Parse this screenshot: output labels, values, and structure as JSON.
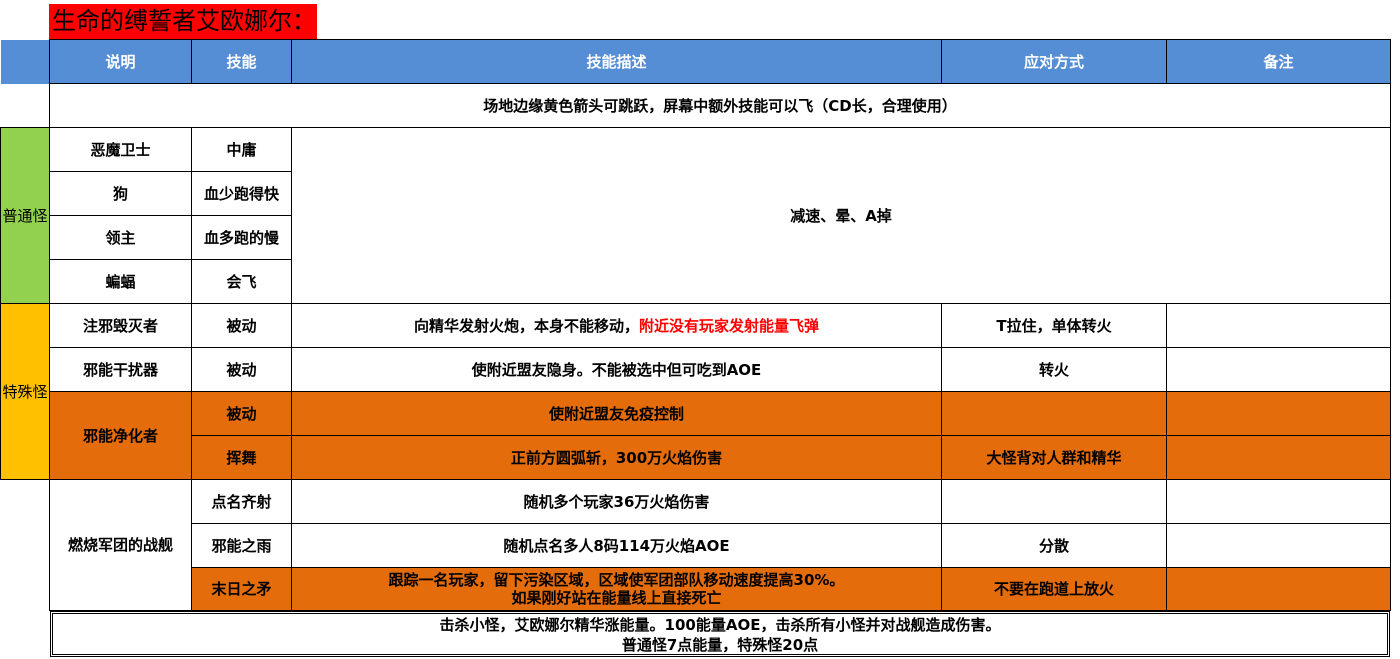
{
  "title": "生命的缚誓者艾欧娜尔：",
  "header": {
    "col1": "说明",
    "col2": "技能",
    "col3": "技能描述",
    "col4": "应对方式",
    "col5": "备注"
  },
  "intro_note": "场地边缘黄色箭头可跳跃，屏幕中额外技能可以飞（CD长，合理使用）",
  "normal_group": {
    "label": "普通怪",
    "counter": "减速、晕、A掉",
    "rows": [
      {
        "name": "恶魔卫士",
        "skill": "中庸"
      },
      {
        "name": "狗",
        "skill": "血少跑得快"
      },
      {
        "name": "领主",
        "skill": "血多跑的慢"
      },
      {
        "name": "蝙蝠",
        "skill": "会飞"
      }
    ]
  },
  "special_group": {
    "label": "特殊怪",
    "row1": {
      "name": "注邪毁灭者",
      "skill": "被动",
      "desc_plain": "向精华发射火炮，本身不能移动，",
      "desc_red": "附近没有玩家发射能量飞弹",
      "counter": "T拉住，单体转火",
      "note": ""
    },
    "row2": {
      "name": "邪能干扰器",
      "skill": "被动",
      "desc": "使附近盟友隐身。不能被选中但可吃到AOE",
      "counter": "转火",
      "note": ""
    },
    "purifier": {
      "name": "邪能净化者",
      "skill1": "被动",
      "desc1": "使附近盟友免疫控制",
      "counter1": "",
      "skill2": "挥舞",
      "desc2": "正前方圆弧斩，300万火焰伤害",
      "counter2": "大怪背对人群和精华"
    }
  },
  "warship": {
    "name": "燃烧军团的战舰",
    "row1": {
      "skill": "点名齐射",
      "desc": "随机多个玩家36万火焰伤害",
      "counter": ""
    },
    "row2": {
      "skill": "邪能之雨",
      "desc": "随机点名多人8码114万火焰AOE",
      "counter": "分散"
    },
    "row3": {
      "skill": "末日之矛",
      "desc_line1": "跟踪一名玩家，留下污染区域，区域使军团部队移动速度提高30%。",
      "desc_line2": "如果刚好站在能量线上直接死亡",
      "counter": "不要在跑道上放火"
    }
  },
  "footer": {
    "line1": "击杀小怪，艾欧娜尔精华涨能量。100能量AOE，击杀所有小怪并对战舰造成伤害。",
    "line2": "普通怪7点能量，特殊怪20点"
  },
  "colors": {
    "header_blue": "#558ed5",
    "normal_green": "#92d050",
    "special_yellow": "#ffc000",
    "highlight_orange": "#e46c0a",
    "title_red": "#ff0000"
  }
}
